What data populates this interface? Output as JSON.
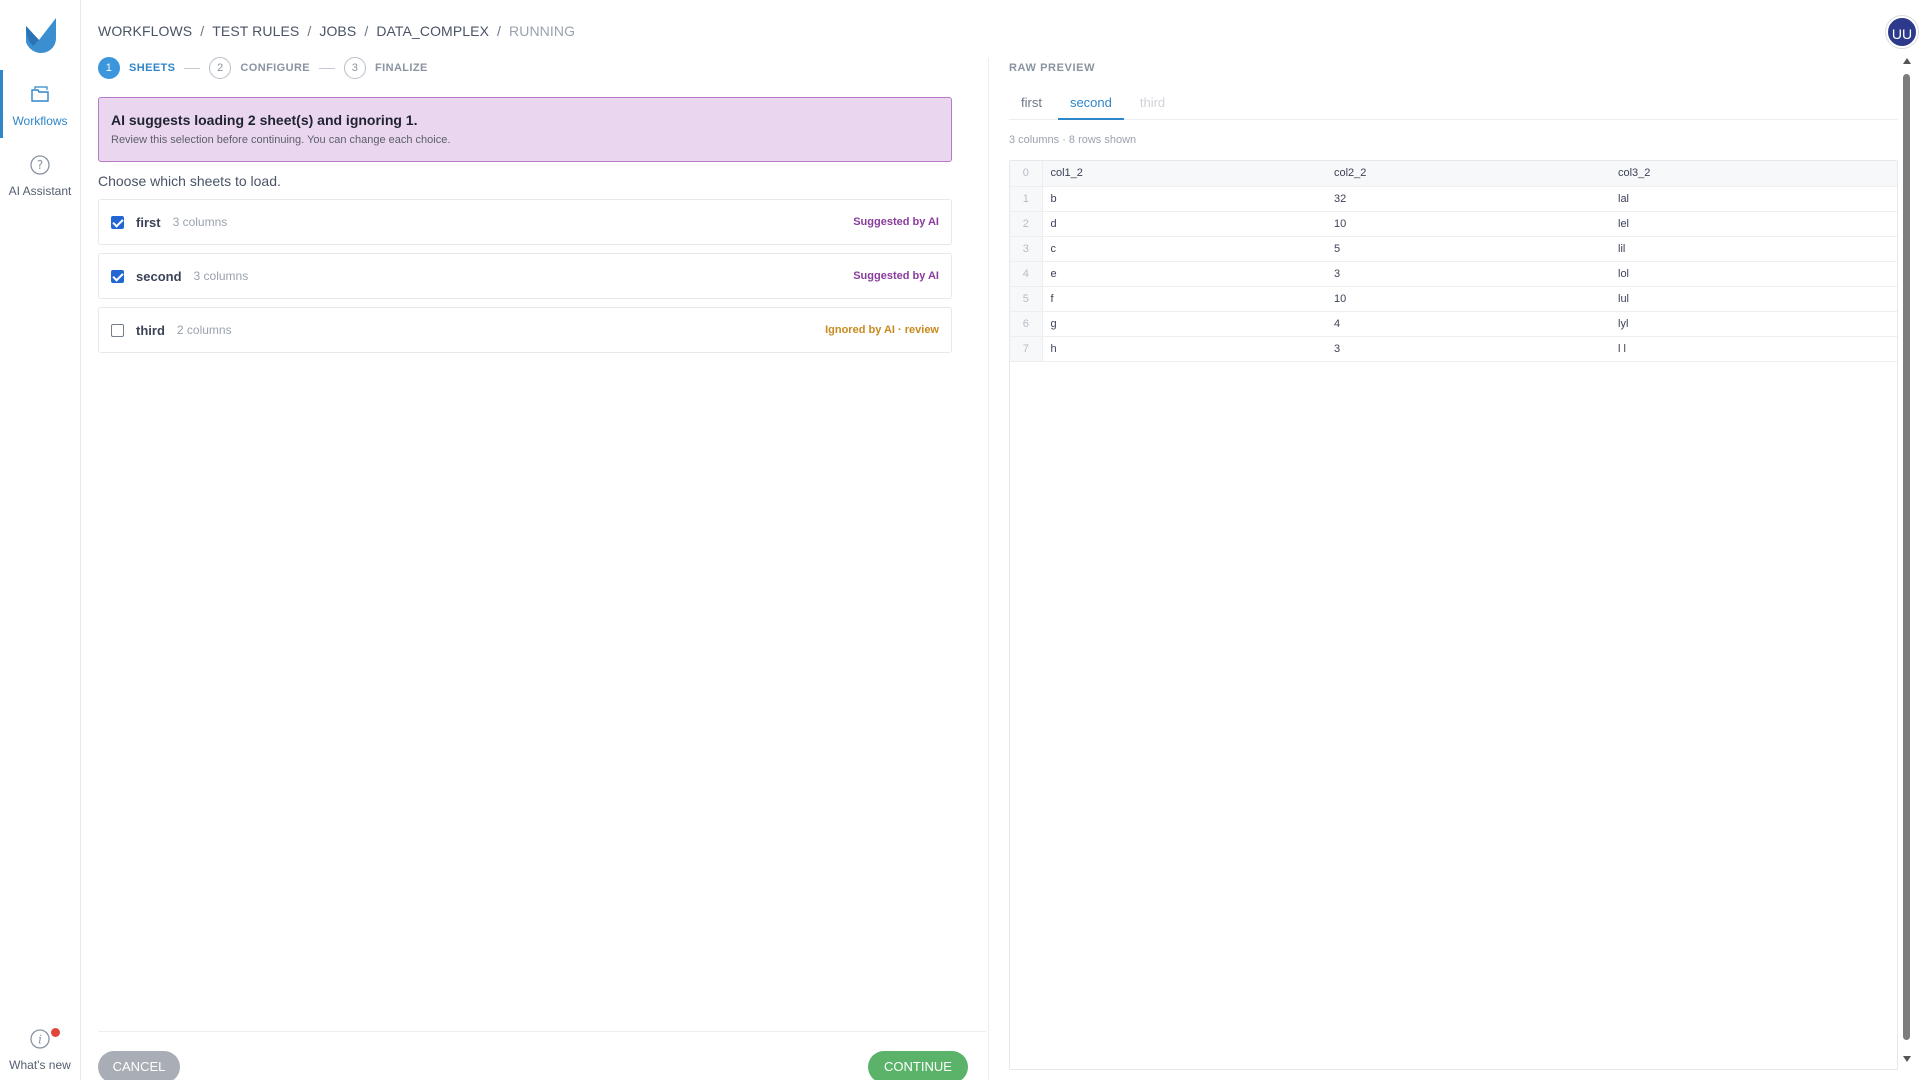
{
  "sidebar": {
    "workflows_label": "Workflows",
    "ai_label": "AI Assistant",
    "whatsnew_label": "What's new"
  },
  "breadcrumb": [
    "WORKFLOWS",
    "TEST RULES",
    "JOBS",
    "DATA_COMPLEX",
    "RUNNING"
  ],
  "user": {
    "initials": "UU"
  },
  "stepper": [
    {
      "num": "1",
      "label": "SHEETS",
      "active": true
    },
    {
      "num": "2",
      "label": "CONFIGURE",
      "active": false
    },
    {
      "num": "3",
      "label": "FINALIZE",
      "active": false
    }
  ],
  "banner": {
    "title": "AI suggests loading 2 sheet(s) and ignoring 1.",
    "subtitle": "Review this selection before continuing. You can change each choice."
  },
  "choose_label": "Choose which sheets to load.",
  "sheets": [
    {
      "name": "first",
      "cols": "3 columns",
      "checked": true,
      "tag": "Suggested by AI",
      "tag_type": "suggested"
    },
    {
      "name": "second",
      "cols": "3 columns",
      "checked": true,
      "tag": "Suggested by AI",
      "tag_type": "suggested"
    },
    {
      "name": "third",
      "cols": "2 columns",
      "checked": false,
      "tag": "Ignored by AI · review",
      "tag_type": "ignored"
    }
  ],
  "footer": {
    "cancel": "CANCEL",
    "continue": "CONTINUE"
  },
  "preview": {
    "title": "RAW PREVIEW",
    "tabs": [
      {
        "label": "first",
        "state": "normal"
      },
      {
        "label": "second",
        "state": "active"
      },
      {
        "label": "third",
        "state": "disabled"
      }
    ],
    "meta": "3 columns · 8 rows shown",
    "header": {
      "idx": "0",
      "cols": [
        "col1_2",
        "col2_2",
        "col3_2"
      ]
    },
    "rows": [
      {
        "idx": "1",
        "cells": [
          "b",
          "32",
          "lal"
        ]
      },
      {
        "idx": "2",
        "cells": [
          "d",
          "10",
          "lel"
        ]
      },
      {
        "idx": "3",
        "cells": [
          "c",
          "5",
          "lil"
        ]
      },
      {
        "idx": "4",
        "cells": [
          "e",
          "3",
          "lol"
        ]
      },
      {
        "idx": "5",
        "cells": [
          "f",
          "10",
          "lul"
        ]
      },
      {
        "idx": "6",
        "cells": [
          "g",
          "4",
          "lyl"
        ]
      },
      {
        "idx": "7",
        "cells": [
          "h",
          "3",
          "l l"
        ]
      }
    ]
  },
  "colors": {
    "accent": "#2f86c9",
    "ai_purple": "#8a3c9c",
    "warning": "#c88a1e",
    "continue": "#5bb36a"
  }
}
